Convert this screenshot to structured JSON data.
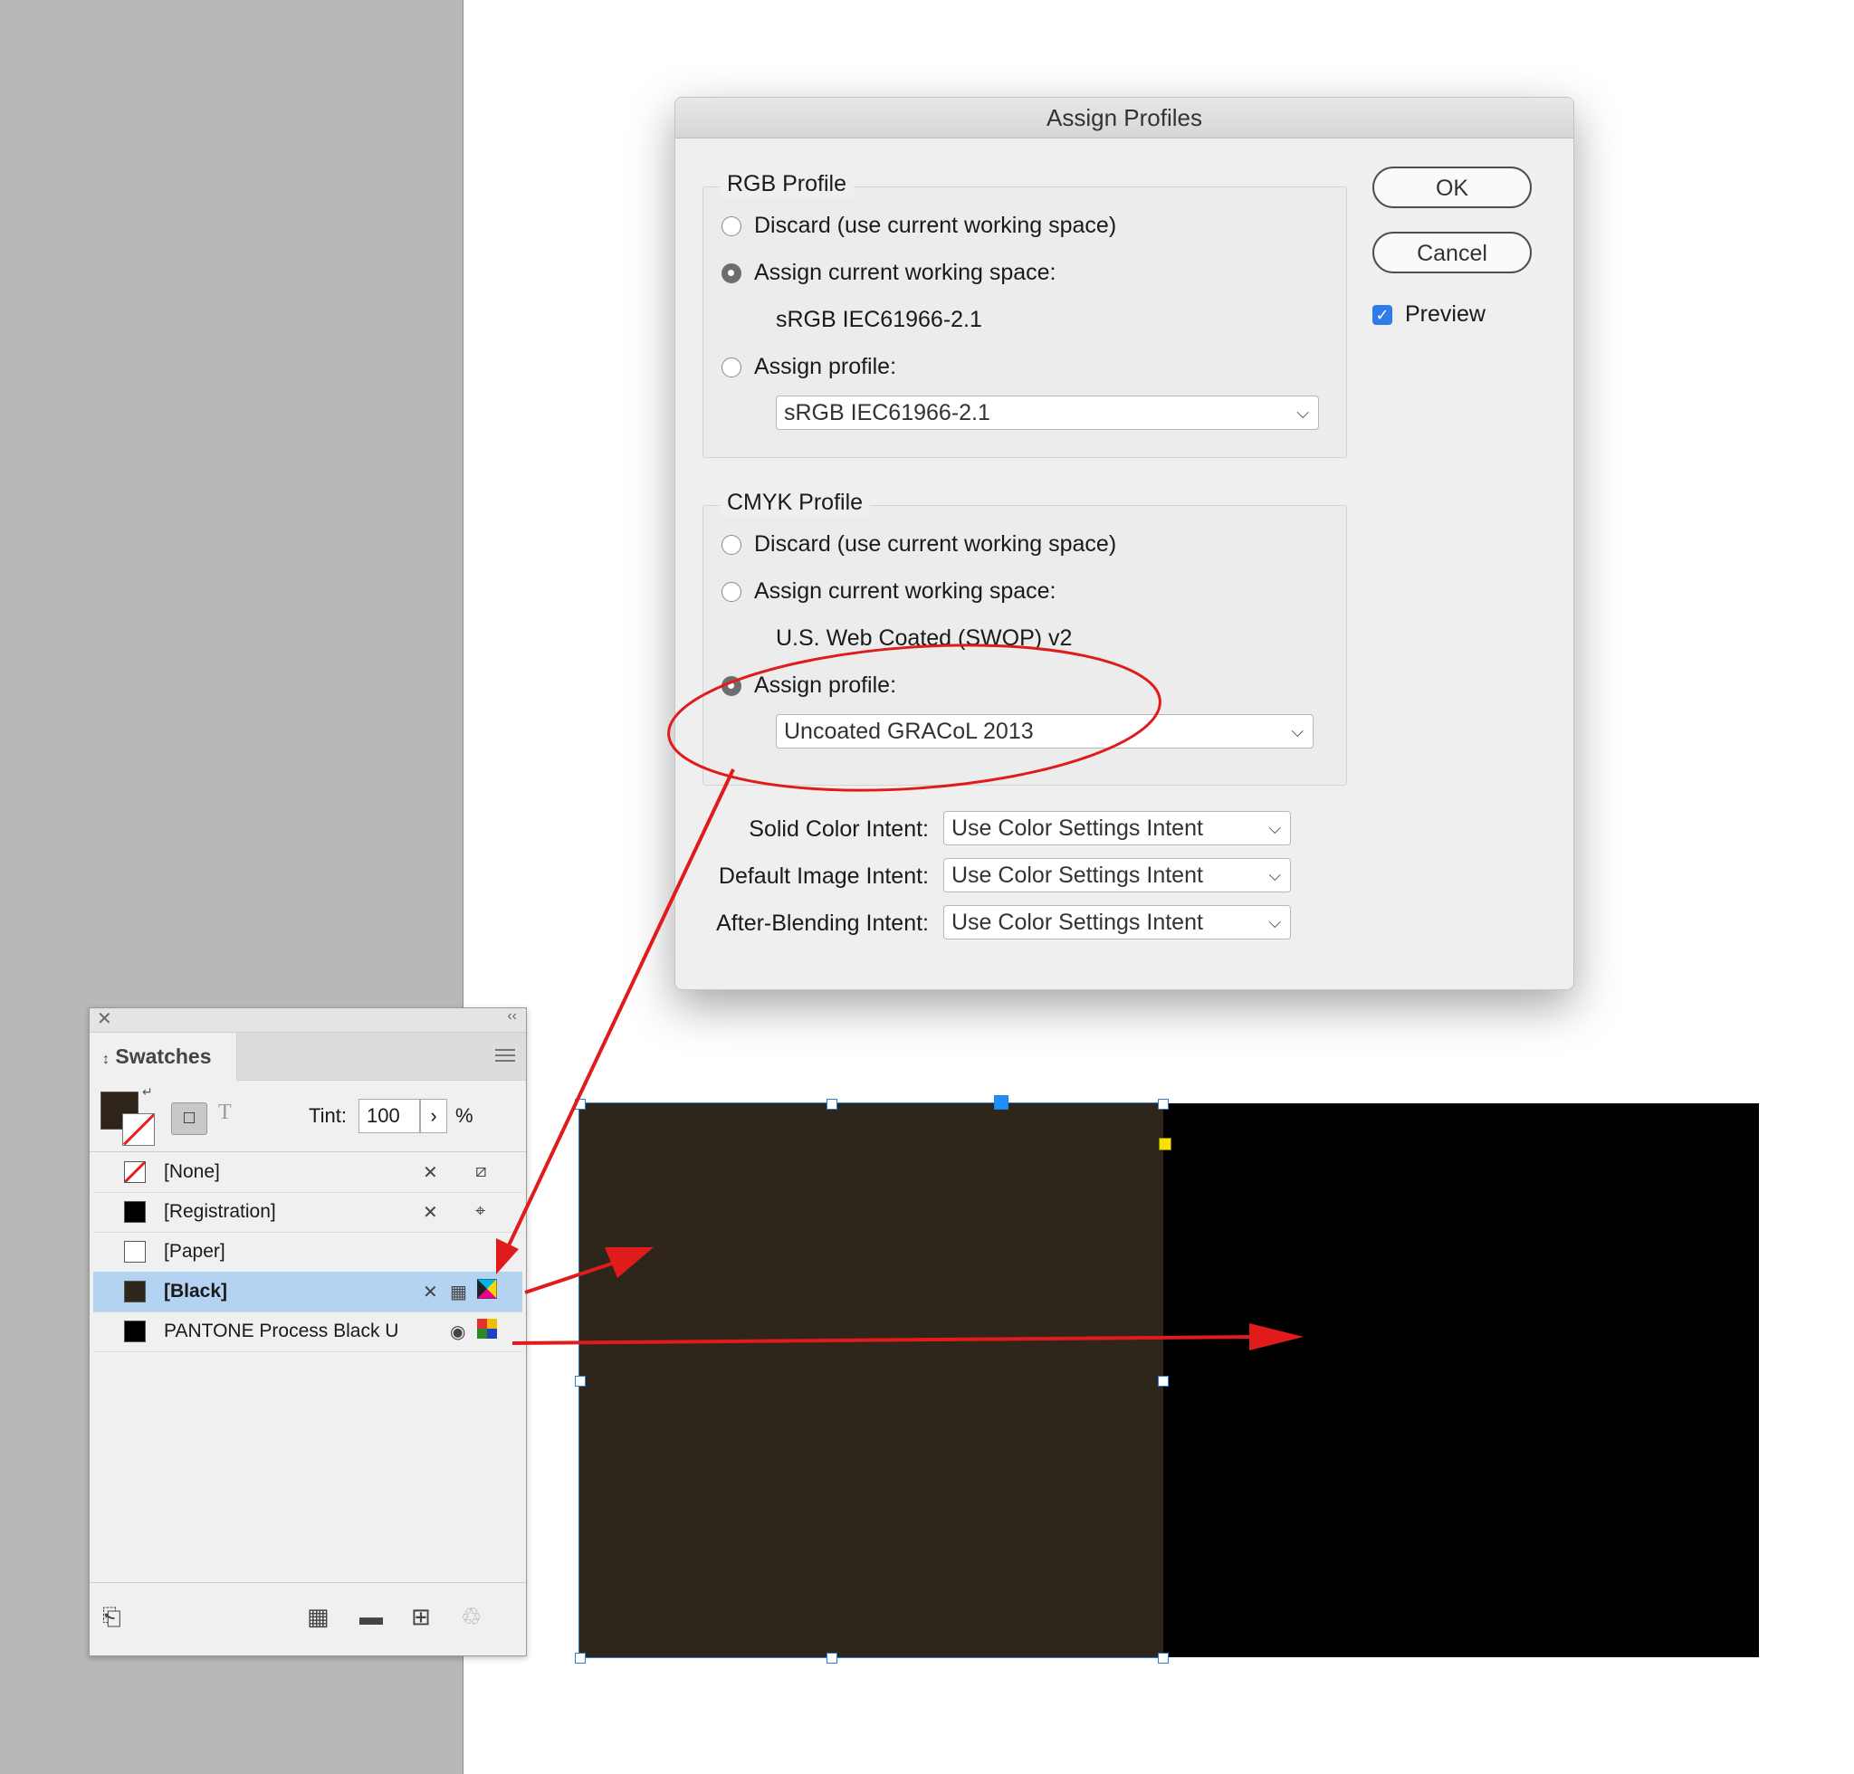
{
  "dialog": {
    "title": "Assign Profiles",
    "ok_label": "OK",
    "cancel_label": "Cancel",
    "preview_label": "Preview",
    "rgb": {
      "legend": "RGB Profile",
      "discard_label": "Discard (use current working space)",
      "assign_current_label": "Assign current working space:",
      "current_space": "sRGB IEC61966-2.1",
      "assign_profile_label": "Assign profile:",
      "profile_value": "sRGB IEC61966-2.1"
    },
    "cmyk": {
      "legend": "CMYK Profile",
      "discard_label": "Discard (use current working space)",
      "assign_current_label": "Assign current working space:",
      "current_space": "U.S. Web Coated (SWOP) v2",
      "assign_profile_label": "Assign profile:",
      "profile_value": "Uncoated GRACoL 2013"
    },
    "intents": {
      "solid_label": "Solid Color Intent:",
      "solid_value": "Use Color Settings Intent",
      "image_label": "Default Image Intent:",
      "image_value": "Use Color Settings Intent",
      "blending_label": "After-Blending Intent:",
      "blending_value": "Use Color Settings Intent"
    }
  },
  "swatches": {
    "tab_label": "Swatches",
    "tint_label": "Tint:",
    "tint_value": "100",
    "tint_unit": "%",
    "rows": [
      {
        "name": "[None]"
      },
      {
        "name": "[Registration]"
      },
      {
        "name": "[Paper]"
      },
      {
        "name": "[Black]"
      },
      {
        "name": "PANTONE Process Black U"
      }
    ]
  },
  "colors": {
    "brown_rect": "#2e261b",
    "black_rect": "#000000",
    "annotation": "#e01b1b",
    "selection": "#b4d3f2"
  }
}
